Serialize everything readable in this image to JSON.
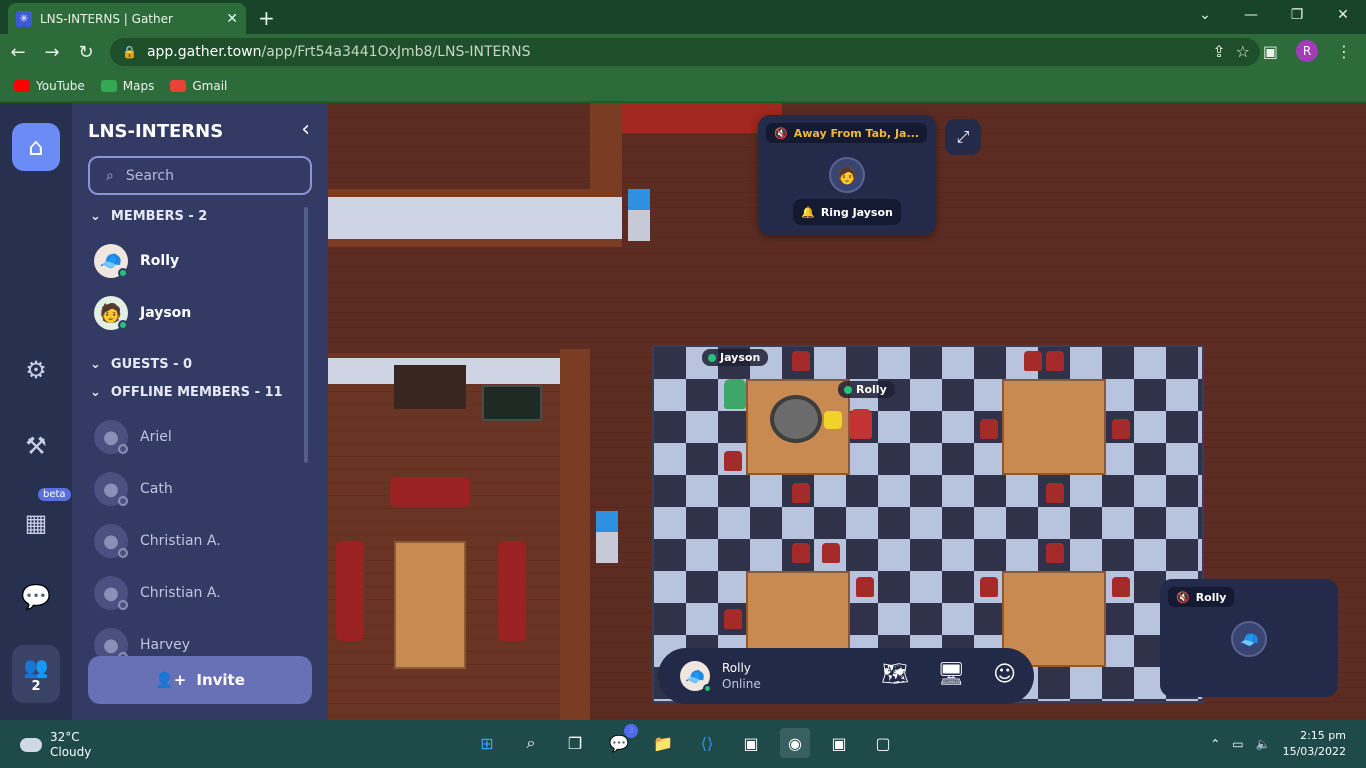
{
  "browser": {
    "tab_title": "LNS-INTERNS | Gather",
    "url_host": "app.gather.town",
    "url_path": "/app/Frt54a3441OxJmb8/LNS-INTERNS",
    "profile_initial": "R",
    "bookmarks": [
      {
        "label": "YouTube",
        "color": "#ff0000"
      },
      {
        "label": "Maps",
        "color": "#34a853"
      },
      {
        "label": "Gmail",
        "color": "#ea4335"
      }
    ]
  },
  "sidebar": {
    "title": "LNS-INTERNS",
    "search_placeholder": "Search",
    "members_header": "MEMBERS - 2",
    "members": [
      {
        "name": "Rolly"
      },
      {
        "name": "Jayson"
      }
    ],
    "guests_header": "GUESTS - 0",
    "offline_header": "OFFLINE MEMBERS - 11",
    "offline_members": [
      {
        "name": "Ariel"
      },
      {
        "name": "Cath"
      },
      {
        "name": "Christian A."
      },
      {
        "name": "Christian A."
      },
      {
        "name": "Harvey"
      }
    ],
    "invite_label": "Invite"
  },
  "rail": {
    "beta_label": "beta",
    "online_count": "2"
  },
  "map": {
    "nameplates": [
      {
        "name": "Jayson"
      },
      {
        "name": "Rolly"
      }
    ],
    "ring_card": {
      "status": "Away From Tab, Ja...",
      "button": "Ring Jayson"
    },
    "video_card": {
      "name": "Rolly"
    }
  },
  "bottombar": {
    "name": "Rolly",
    "status": "Online"
  },
  "taskbar": {
    "temp": "32°C",
    "condition": "Cloudy",
    "teams_badge": "3",
    "time": "2:15 pm",
    "date": "15/03/2022"
  }
}
